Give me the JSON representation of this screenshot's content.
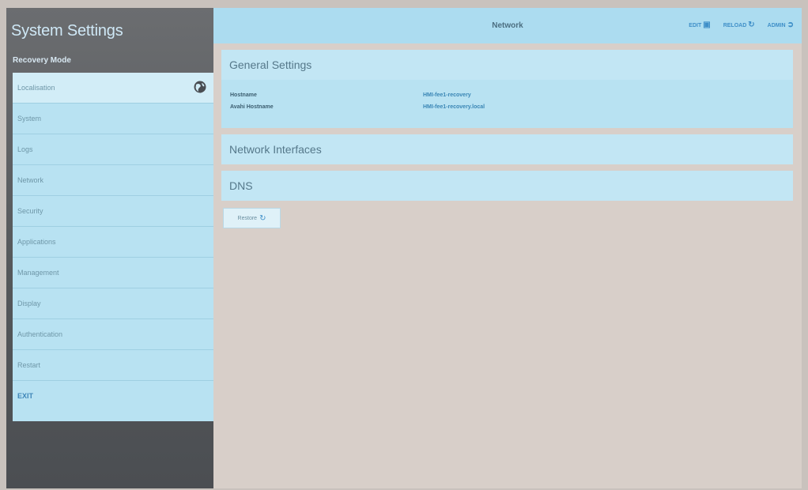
{
  "app": {
    "title": "System Settings",
    "mode": "Recovery Mode"
  },
  "sidebar": {
    "items": [
      {
        "label": "Localisation",
        "active": true
      },
      {
        "label": "System"
      },
      {
        "label": "Logs"
      },
      {
        "label": "Network"
      },
      {
        "label": "Security"
      },
      {
        "label": "Applications"
      },
      {
        "label": "Management"
      },
      {
        "label": "Display"
      },
      {
        "label": "Authentication"
      },
      {
        "label": "Restart"
      },
      {
        "label": "EXIT"
      }
    ]
  },
  "header": {
    "title": "Network",
    "edit_label": "EDIT",
    "reload_label": "RELOAD",
    "admin_label": "ADMIN"
  },
  "general": {
    "title": "General Settings",
    "rows": [
      {
        "key": "Hostname",
        "value": "HMI-fee1-recovery"
      },
      {
        "key": "Avahi Hostname",
        "value": "HMI-fee1-recovery.local"
      }
    ]
  },
  "interfaces": {
    "title": "Network Interfaces"
  },
  "dns": {
    "title": "DNS"
  },
  "restore": {
    "label": "Restore"
  },
  "colors": {
    "accent": "#3f8fc8",
    "panel": "#b8e2f2",
    "sidebar": "#5a5d61"
  }
}
